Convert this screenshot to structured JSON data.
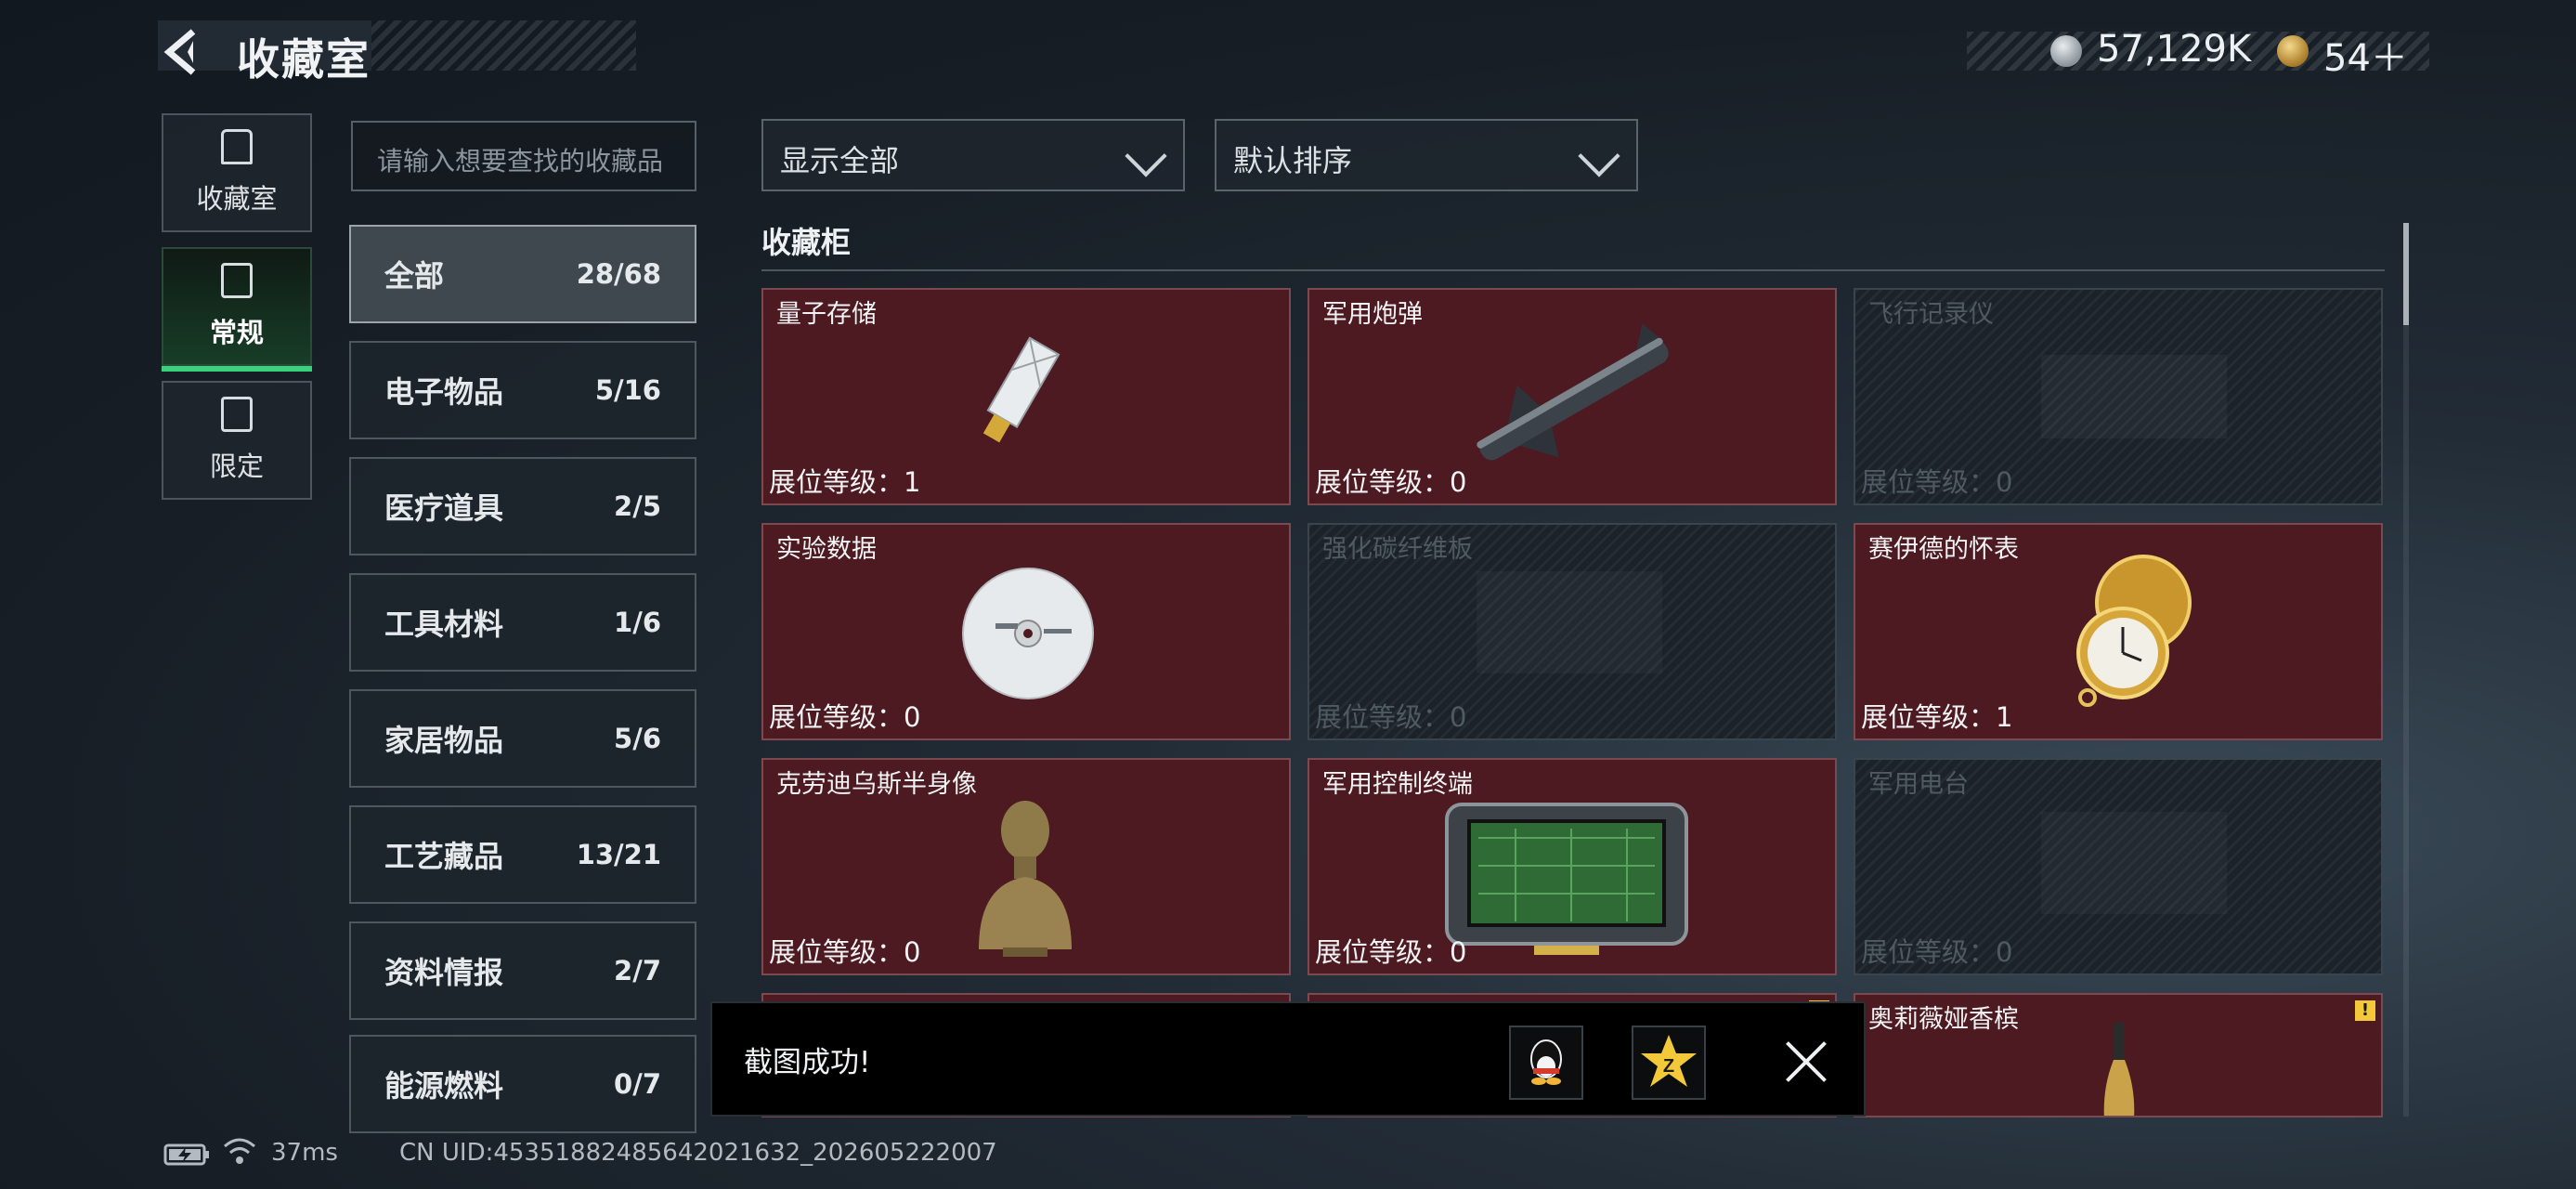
{
  "header": {
    "title": "收藏室",
    "currency_silver": "57,129K",
    "currency_gold": "54＋"
  },
  "nav": [
    {
      "label": "收藏室",
      "icon": "trash-can-icon",
      "active": false
    },
    {
      "label": "常规",
      "icon": "document-icon",
      "active": true
    },
    {
      "label": "限定",
      "icon": "image-icon",
      "active": false
    }
  ],
  "search": {
    "placeholder": "请输入想要查找的收藏品"
  },
  "categories": [
    {
      "name": "全部",
      "count": "28/68",
      "active": true
    },
    {
      "name": "电子物品",
      "count": "5/16"
    },
    {
      "name": "医疗道具",
      "count": "2/5"
    },
    {
      "name": "工具材料",
      "count": "1/6"
    },
    {
      "name": "家居物品",
      "count": "5/6"
    },
    {
      "name": "工艺藏品",
      "count": "13/21"
    },
    {
      "name": "资料情报",
      "count": "2/7"
    },
    {
      "name": "能源燃料",
      "count": "0/7"
    }
  ],
  "filters": {
    "show": "显示全部",
    "sort": "默认排序"
  },
  "section": {
    "title": "收藏柜"
  },
  "cards": [
    {
      "name": "量子存储",
      "level": "展位等级：1",
      "locked": false,
      "icon": "usb-drive-icon"
    },
    {
      "name": "军用炮弹",
      "level": "展位等级：0",
      "locked": false,
      "icon": "missile-icon"
    },
    {
      "name": "飞行记录仪",
      "level": "展位等级：0",
      "locked": true,
      "icon": "flight-recorder-icon"
    },
    {
      "name": "实验数据",
      "level": "展位等级：0",
      "locked": false,
      "icon": "cd-disc-icon"
    },
    {
      "name": "强化碳纤维板",
      "level": "展位等级：0",
      "locked": true,
      "icon": "carbon-plate-icon"
    },
    {
      "name": "赛伊德的怀表",
      "level": "展位等级：1",
      "locked": false,
      "icon": "pocket-watch-icon"
    },
    {
      "name": "克劳迪乌斯半身像",
      "level": "展位等级：0",
      "locked": false,
      "icon": "bust-statue-icon"
    },
    {
      "name": "军用控制终端",
      "level": "展位等级：0",
      "locked": false,
      "icon": "control-terminal-icon"
    },
    {
      "name": "军用电台",
      "level": "展位等级：0",
      "locked": true,
      "icon": "radio-icon"
    },
    {
      "name": "",
      "level": "",
      "locked": false,
      "icon": ""
    },
    {
      "name": "",
      "level": "",
      "locked": false,
      "alert": "!",
      "icon": ""
    },
    {
      "name": "奥莉薇娅香槟",
      "level": "",
      "locked": false,
      "alert": "!",
      "icon": "champagne-bottle-icon"
    }
  ],
  "toast": {
    "text": "截图成功!",
    "share_qq": "qq-share-icon",
    "share_qzone": "qzone-share-icon"
  },
  "status": {
    "ping": "37ms",
    "uid": "CN UID:4535188248564202163​2_202605222007"
  }
}
